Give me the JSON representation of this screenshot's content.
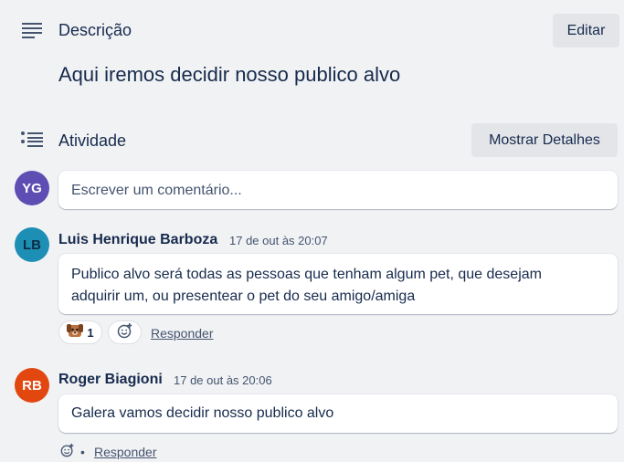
{
  "description": {
    "icon": "description-lines-icon",
    "title": "Descrição",
    "edit_label": "Editar",
    "text": "Aqui iremos decidir nosso publico alvo"
  },
  "activity": {
    "icon": "activity-list-icon",
    "title": "Atividade",
    "details_label": "Mostrar Detalhes",
    "current_user_initials": "YG",
    "comment_placeholder": "Escrever um comentário..."
  },
  "comments": [
    {
      "initials": "LB",
      "author": "Luis Henrique Barboza",
      "time": "17 de out às 20:07",
      "text_line1": "Publico alvo será todas as pessoas que tenham algum pet, que desejam",
      "text_line2": "adquirir um, ou presentear o pet do seu amigo/amiga",
      "reaction_icon": "dog-emoji-icon",
      "reaction_count": "1",
      "reply_label": "Responder"
    },
    {
      "initials": "RB",
      "author": "Roger Biagioni",
      "time": "17 de out às 20:06",
      "text": "Galera vamos decidir nosso publico alvo",
      "separator": "•",
      "reply_label": "Responder"
    }
  ],
  "colors": {
    "background": "#f1f2f4",
    "avatar_yg": "#5e4db2",
    "avatar_lb": "#1d8fb5",
    "avatar_rb": "#e34710",
    "text": "#172b4d"
  }
}
